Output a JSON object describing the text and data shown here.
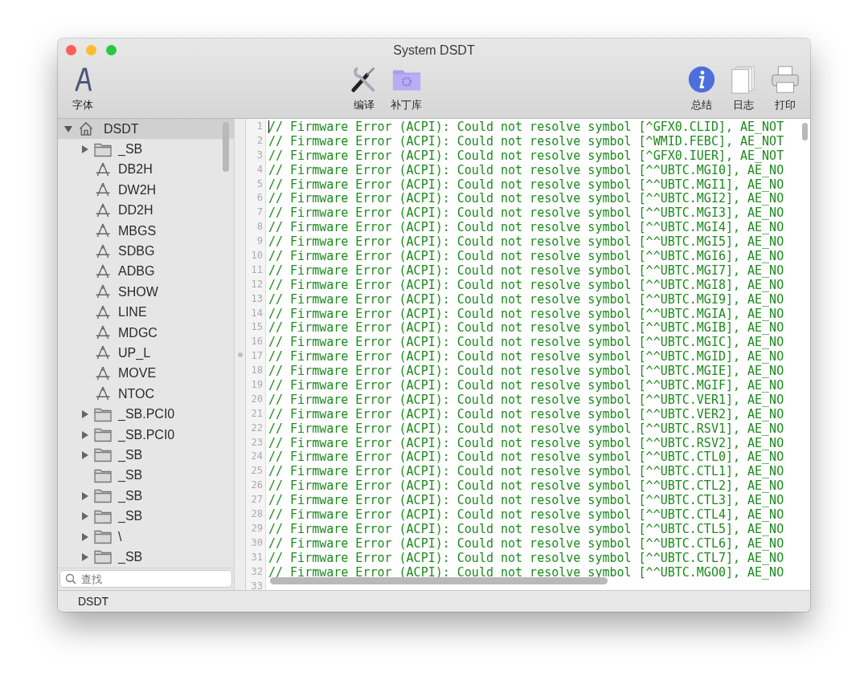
{
  "window": {
    "title": "System DSDT"
  },
  "toolbar": {
    "left": [
      {
        "label": "字体",
        "kind": "font"
      }
    ],
    "center": [
      {
        "label": "编译",
        "kind": "compile"
      },
      {
        "label": "补丁库",
        "kind": "patch"
      }
    ],
    "right": [
      {
        "label": "总结",
        "kind": "info"
      },
      {
        "label": "日志",
        "kind": "log"
      },
      {
        "label": "打印",
        "kind": "print"
      }
    ]
  },
  "sidebar": {
    "tree": [
      {
        "label": "DSDT",
        "kind": "home",
        "expanded": true,
        "selected": true,
        "children": [
          {
            "label": "_SB",
            "kind": "folder",
            "expandable": true,
            "selected": false
          },
          {
            "label": "DB2H",
            "kind": "method",
            "expandable": false,
            "selected": false
          },
          {
            "label": "DW2H",
            "kind": "method",
            "expandable": false,
            "selected": false
          },
          {
            "label": "DD2H",
            "kind": "method",
            "expandable": false,
            "selected": false
          },
          {
            "label": "MBGS",
            "kind": "method",
            "expandable": false,
            "selected": false
          },
          {
            "label": "SDBG",
            "kind": "method",
            "expandable": false,
            "selected": false
          },
          {
            "label": "ADBG",
            "kind": "method",
            "expandable": false,
            "selected": false
          },
          {
            "label": "SHOW",
            "kind": "method",
            "expandable": false,
            "selected": false
          },
          {
            "label": "LINE",
            "kind": "method",
            "expandable": false,
            "selected": false
          },
          {
            "label": "MDGC",
            "kind": "method",
            "expandable": false,
            "selected": false
          },
          {
            "label": "UP_L",
            "kind": "method",
            "expandable": false,
            "selected": false
          },
          {
            "label": "MOVE",
            "kind": "method",
            "expandable": false,
            "selected": false
          },
          {
            "label": "NTOC",
            "kind": "method",
            "expandable": false,
            "selected": false
          },
          {
            "label": "_SB.PCI0",
            "kind": "folder",
            "expandable": true,
            "selected": false
          },
          {
            "label": "_SB.PCI0",
            "kind": "folder",
            "expandable": true,
            "selected": false
          },
          {
            "label": "_SB",
            "kind": "folder",
            "expandable": true,
            "selected": false
          },
          {
            "label": "_SB",
            "kind": "folder",
            "expandable": false,
            "selected": false
          },
          {
            "label": "_SB",
            "kind": "folder",
            "expandable": true,
            "selected": false
          },
          {
            "label": "_SB",
            "kind": "folder",
            "expandable": true,
            "selected": false
          },
          {
            "label": "\\",
            "kind": "folder",
            "expandable": true,
            "selected": false
          },
          {
            "label": "_SB",
            "kind": "folder",
            "expandable": true,
            "selected": false
          }
        ]
      }
    ],
    "search": {
      "placeholder": "查找"
    }
  },
  "editor": {
    "lines": [
      {
        "number": "1",
        "text": "// Firmware Error (ACPI): Could not resolve symbol [^GFX0.CLID], AE_NOT"
      },
      {
        "number": "2",
        "text": "// Firmware Error (ACPI): Could not resolve symbol [^WMID.FEBC], AE_NOT"
      },
      {
        "number": "3",
        "text": "// Firmware Error (ACPI): Could not resolve symbol [^GFX0.IUER], AE_NOT"
      },
      {
        "number": "4",
        "text": "// Firmware Error (ACPI): Could not resolve symbol [^^UBTC.MGI0], AE_NO"
      },
      {
        "number": "5",
        "text": "// Firmware Error (ACPI): Could not resolve symbol [^^UBTC.MGI1], AE_NO"
      },
      {
        "number": "6",
        "text": "// Firmware Error (ACPI): Could not resolve symbol [^^UBTC.MGI2], AE_NO"
      },
      {
        "number": "7",
        "text": "// Firmware Error (ACPI): Could not resolve symbol [^^UBTC.MGI3], AE_NO"
      },
      {
        "number": "8",
        "text": "// Firmware Error (ACPI): Could not resolve symbol [^^UBTC.MGI4], AE_NO"
      },
      {
        "number": "9",
        "text": "// Firmware Error (ACPI): Could not resolve symbol [^^UBTC.MGI5], AE_NO"
      },
      {
        "number": "10",
        "text": "// Firmware Error (ACPI): Could not resolve symbol [^^UBTC.MGI6], AE_NO"
      },
      {
        "number": "11",
        "text": "// Firmware Error (ACPI): Could not resolve symbol [^^UBTC.MGI7], AE_NO"
      },
      {
        "number": "12",
        "text": "// Firmware Error (ACPI): Could not resolve symbol [^^UBTC.MGI8], AE_NO"
      },
      {
        "number": "13",
        "text": "// Firmware Error (ACPI): Could not resolve symbol [^^UBTC.MGI9], AE_NO"
      },
      {
        "number": "14",
        "text": "// Firmware Error (ACPI): Could not resolve symbol [^^UBTC.MGIA], AE_NO"
      },
      {
        "number": "15",
        "text": "// Firmware Error (ACPI): Could not resolve symbol [^^UBTC.MGIB], AE_NO"
      },
      {
        "number": "16",
        "text": "// Firmware Error (ACPI): Could not resolve symbol [^^UBTC.MGIC], AE_NO"
      },
      {
        "number": "17",
        "text": "// Firmware Error (ACPI): Could not resolve symbol [^^UBTC.MGID], AE_NO"
      },
      {
        "number": "18",
        "text": "// Firmware Error (ACPI): Could not resolve symbol [^^UBTC.MGIE], AE_NO"
      },
      {
        "number": "19",
        "text": "// Firmware Error (ACPI): Could not resolve symbol [^^UBTC.MGIF], AE_NO"
      },
      {
        "number": "20",
        "text": "// Firmware Error (ACPI): Could not resolve symbol [^^UBTC.VER1], AE_NO"
      },
      {
        "number": "21",
        "text": "// Firmware Error (ACPI): Could not resolve symbol [^^UBTC.VER2], AE_NO"
      },
      {
        "number": "22",
        "text": "// Firmware Error (ACPI): Could not resolve symbol [^^UBTC.RSV1], AE_NO"
      },
      {
        "number": "23",
        "text": "// Firmware Error (ACPI): Could not resolve symbol [^^UBTC.RSV2], AE_NO"
      },
      {
        "number": "24",
        "text": "// Firmware Error (ACPI): Could not resolve symbol [^^UBTC.CTL0], AE_NO"
      },
      {
        "number": "25",
        "text": "// Firmware Error (ACPI): Could not resolve symbol [^^UBTC.CTL1], AE_NO"
      },
      {
        "number": "26",
        "text": "// Firmware Error (ACPI): Could not resolve symbol [^^UBTC.CTL2], AE_NO"
      },
      {
        "number": "27",
        "text": "// Firmware Error (ACPI): Could not resolve symbol [^^UBTC.CTL3], AE_NO"
      },
      {
        "number": "28",
        "text": "// Firmware Error (ACPI): Could not resolve symbol [^^UBTC.CTL4], AE_NO"
      },
      {
        "number": "29",
        "text": "// Firmware Error (ACPI): Could not resolve symbol [^^UBTC.CTL5], AE_NO"
      },
      {
        "number": "30",
        "text": "// Firmware Error (ACPI): Could not resolve symbol [^^UBTC.CTL6], AE_NO"
      },
      {
        "number": "31",
        "text": "// Firmware Error (ACPI): Could not resolve symbol [^^UBTC.CTL7], AE_NO"
      },
      {
        "number": "32",
        "text": "// Firmware Error (ACPI): Could not resolve symbol [^^UBTC.MGO0], AE_NO"
      },
      {
        "number": "33"
      }
    ]
  },
  "status_bar": {
    "text": "DSDT"
  }
}
